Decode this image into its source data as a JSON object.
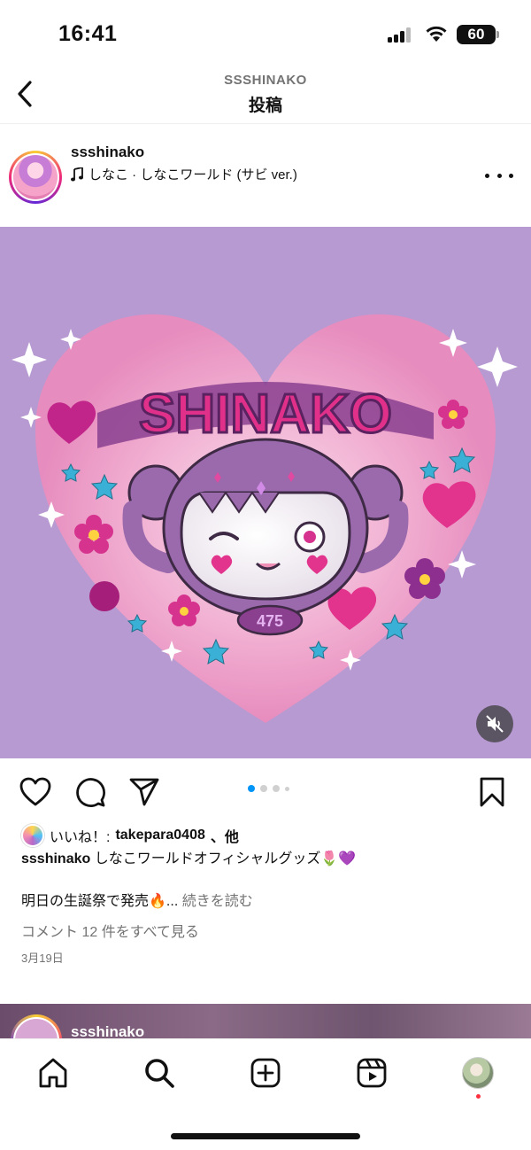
{
  "status_bar": {
    "time": "16:41",
    "battery": "60"
  },
  "header": {
    "subtitle": "SSSHINAKO",
    "title": "投稿"
  },
  "post": {
    "username": "ssshinako",
    "music": "しなこ · しなこワールド (サビ ver.)",
    "artwork": {
      "logo_text": "SHINAKO",
      "badge_text": "475"
    },
    "carousel": {
      "total": 4,
      "active_index": 0
    },
    "likes": {
      "prefix": "いいね！: ",
      "user": "takepara0408",
      "suffix": "、他"
    },
    "caption_username": "ssshinako",
    "caption_text": "しなこワールドオフィシャルグッズ🌷💜",
    "caption_line2": "明日の生誕祭で発売🔥...",
    "read_more": "続きを読む",
    "comments_link": "コメント 12 件をすべて見る",
    "date": "3月19日"
  },
  "next_post": {
    "username": "ssshinako"
  },
  "colors": {
    "background_purple": "#b79ad1",
    "heart_pink": "#f29ac4",
    "magenta": "#d6338f",
    "accent_blue": "#0095f6",
    "notification_red": "#ff3040"
  },
  "icons": {
    "back": "chevron-left-icon",
    "more": "more-horizontal-icon",
    "like": "heart-icon",
    "comment": "comment-bubble-icon",
    "share": "paper-plane-icon",
    "save": "bookmark-icon",
    "mute": "speaker-muted-icon",
    "nav": [
      "home-icon",
      "search-icon",
      "create-plus-icon",
      "reels-icon",
      "profile-avatar"
    ]
  }
}
